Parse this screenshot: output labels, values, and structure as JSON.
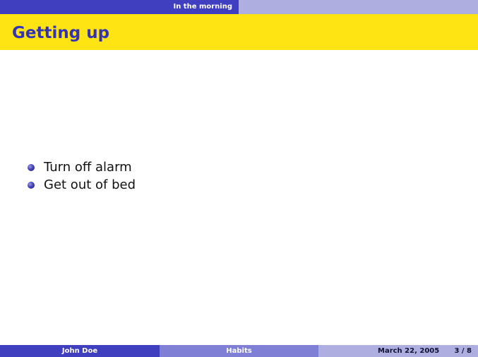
{
  "header": {
    "section": "In the morning"
  },
  "slide": {
    "title": "Getting up",
    "bullets": [
      "Turn off alarm",
      "Get out of bed"
    ]
  },
  "footer": {
    "author": "John Doe",
    "short_title": "Habits",
    "date": "March 22, 2005",
    "page": "3 / 8"
  },
  "colors": {
    "accent_dark": "#3f3fbf",
    "accent_mid": "#7f7fd5",
    "accent_light": "#aeaee0",
    "title_band": "#ffe414",
    "title_text": "#3333b3"
  }
}
